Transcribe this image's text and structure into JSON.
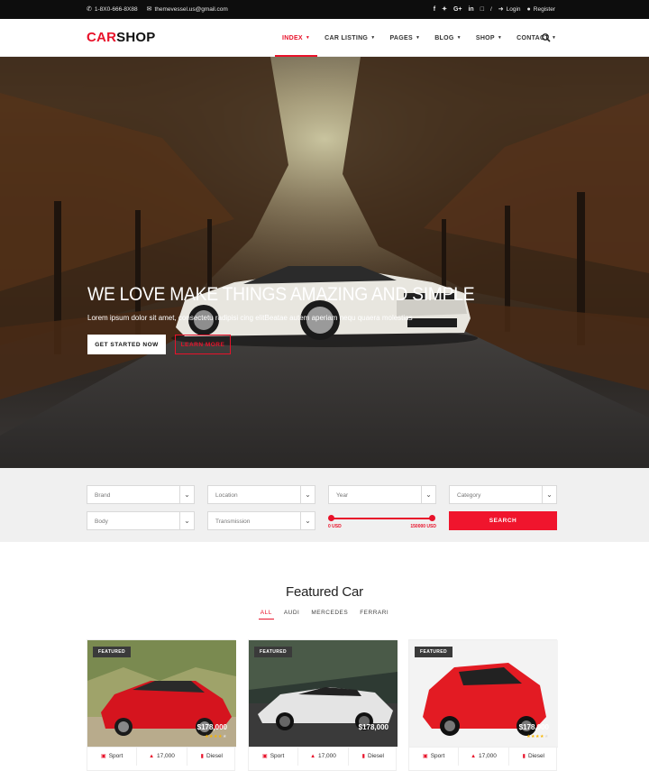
{
  "topbar": {
    "phone": "1-8X0-666-8X88",
    "email": "themevessel.us@gmail.com",
    "separator": "/",
    "login": "Login",
    "register": "Register",
    "social_icons": [
      "facebook-icon",
      "twitter-icon",
      "google-plus-icon",
      "linkedin-icon",
      "instagram-icon"
    ]
  },
  "header": {
    "logo_part1": "CAR",
    "logo_part2": "SHOP",
    "nav": [
      {
        "label": "INDEX",
        "active": true
      },
      {
        "label": "CAR LISTING"
      },
      {
        "label": "PAGES"
      },
      {
        "label": "BLOG"
      },
      {
        "label": "SHOP"
      },
      {
        "label": "CONTACT"
      }
    ]
  },
  "hero": {
    "title": "WE LOVE MAKE THINGS AMAZING AND SIMPLE",
    "subtitle": "Lorem ipsum dolor sit amet, consectetu radipisi cing elitBeatae autem aperiam nequ quaera molestias",
    "primary_button": "GET STARTED NOW",
    "secondary_button": "LEARN MORE"
  },
  "search": {
    "brand": "Brand",
    "location": "Location",
    "year": "Year",
    "category": "Category",
    "body": "Body",
    "transmission": "Transmission",
    "price_min": "0 USD",
    "price_max": "150000 USD",
    "button": "SEARCH"
  },
  "featured": {
    "title": "Featured Car",
    "filters": [
      {
        "label": "ALL",
        "active": true
      },
      {
        "label": "AUDI"
      },
      {
        "label": "MERCEDES"
      },
      {
        "label": "FERRARI"
      }
    ],
    "cards": [
      {
        "badge": "FEATURED",
        "price": "$178,000",
        "rating": 4,
        "type": "Sport",
        "mileage": "17,000",
        "fuel": "Diesel"
      },
      {
        "badge": "FEATURED",
        "price": "$178,000",
        "rating": 4,
        "type": "Sport",
        "mileage": "17,000",
        "fuel": "Diesel"
      },
      {
        "badge": "FEATURED",
        "price": "$178,000",
        "rating": 4,
        "type": "Sport",
        "mileage": "17,000",
        "fuel": "Diesel"
      }
    ]
  },
  "colors": {
    "accent": "#e8122a",
    "topbar": "#0d0d0d",
    "panel": "#f0f0f0"
  }
}
